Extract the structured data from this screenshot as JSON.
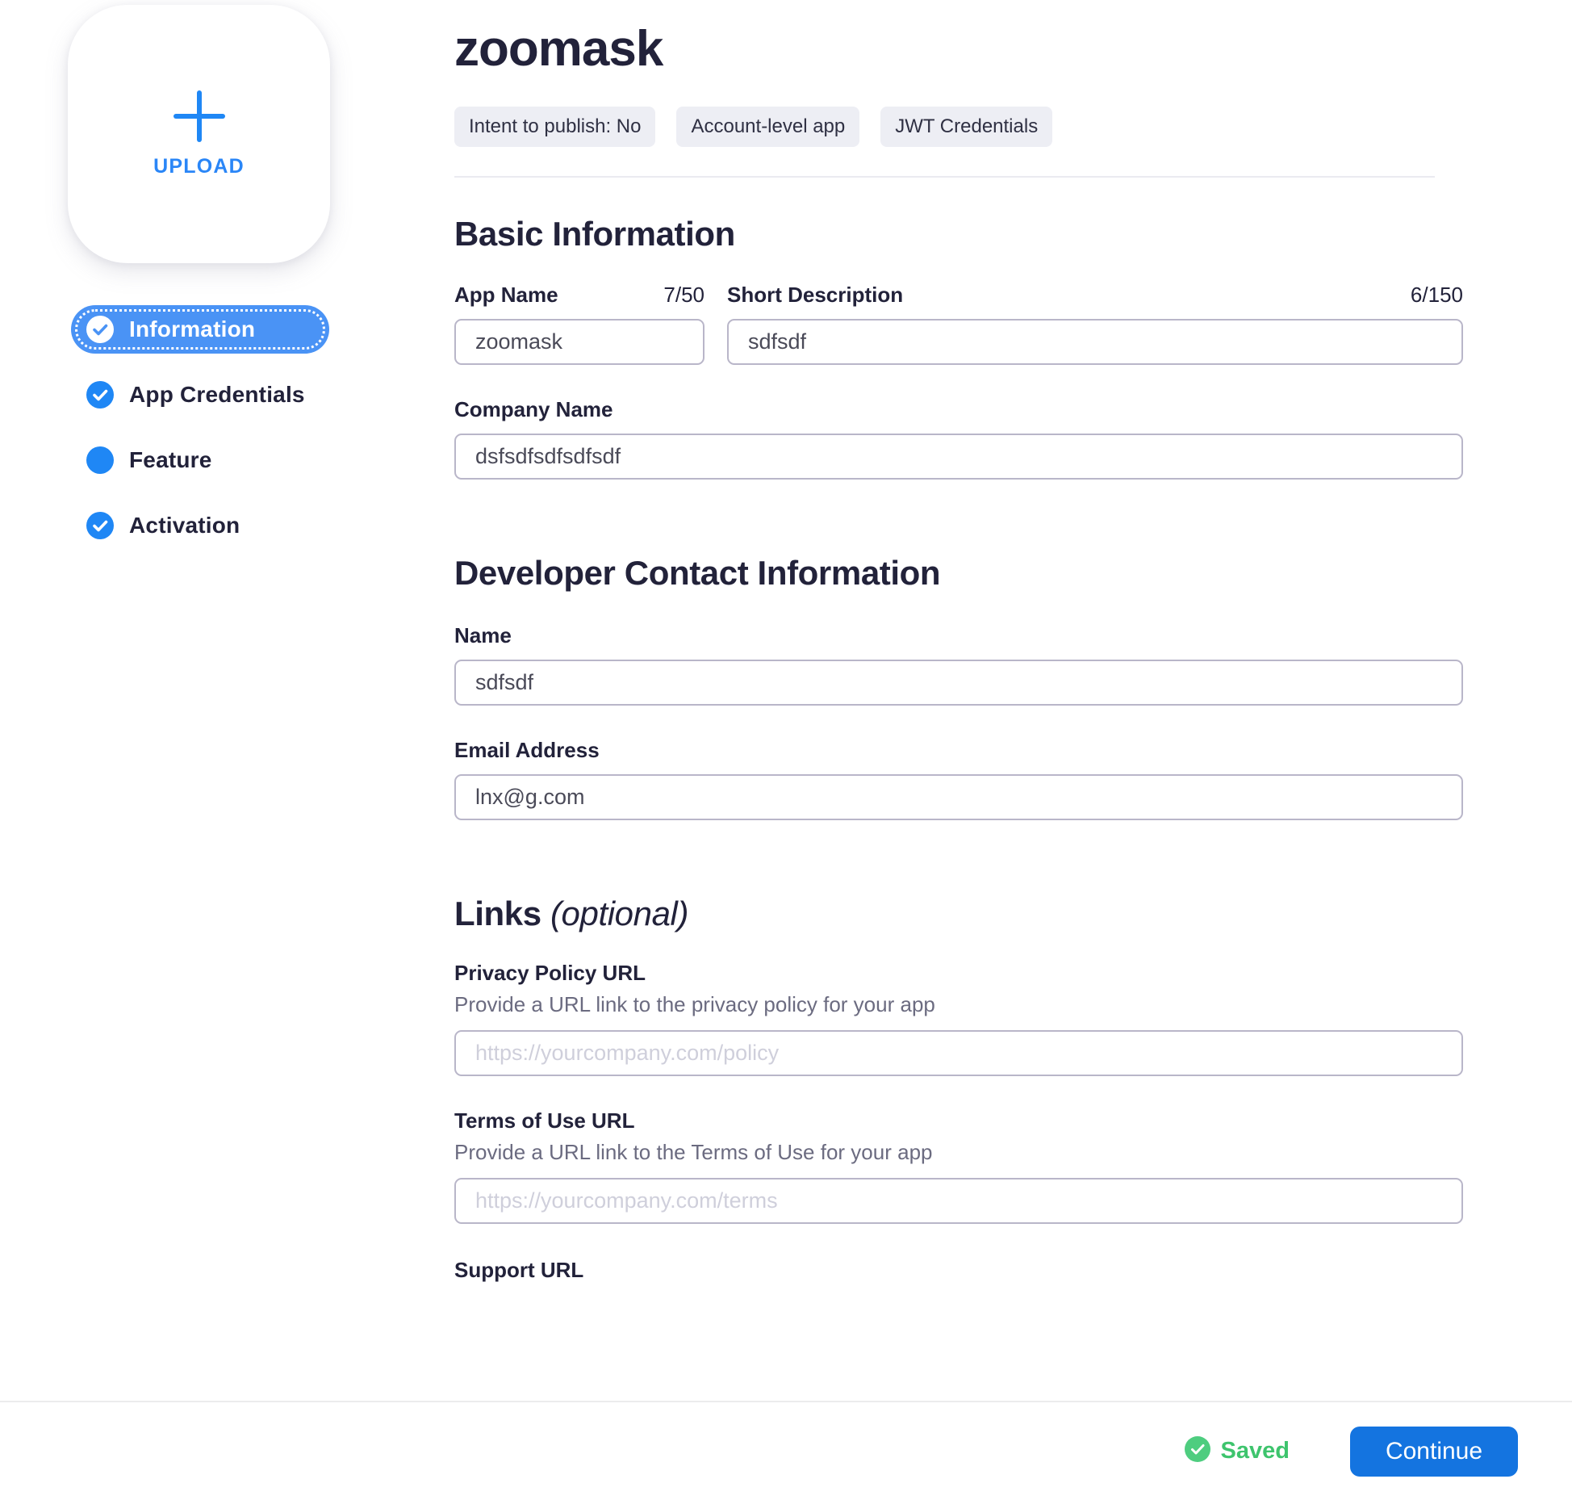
{
  "app": {
    "title": "zoomask",
    "chips": [
      "Intent to publish: No",
      "Account-level app",
      "JWT Credentials"
    ]
  },
  "sidebar": {
    "upload": {
      "label": "UPLOAD",
      "icon": "plus-icon"
    },
    "items": [
      {
        "label": "Information",
        "icon": "check-circle-icon",
        "state": "active"
      },
      {
        "label": "App Credentials",
        "icon": "check-circle-icon",
        "state": "complete"
      },
      {
        "label": "Feature",
        "icon": "dot-circle-icon",
        "state": "incomplete"
      },
      {
        "label": "Activation",
        "icon": "check-circle-icon",
        "state": "complete"
      }
    ]
  },
  "sections": {
    "basic_information": {
      "heading": "Basic Information",
      "app_name": {
        "label": "App Name",
        "counter": "7/50",
        "value": "zoomask",
        "placeholder": ""
      },
      "short_description": {
        "label": "Short Description",
        "counter": "6/150",
        "value": "sdfsdf",
        "placeholder": ""
      },
      "company_name": {
        "label": "Company Name",
        "value": "dsfsdfsdfsdfsdf",
        "placeholder": ""
      }
    },
    "developer_contact": {
      "heading": "Developer Contact Information",
      "name": {
        "label": "Name",
        "value": "sdfsdf",
        "placeholder": ""
      },
      "email": {
        "label": "Email Address",
        "value": "lnx@g.com",
        "placeholder": ""
      }
    },
    "links": {
      "heading": "Links ",
      "heading_optional": "(optional)",
      "privacy_policy": {
        "label": "Privacy Policy URL",
        "help": "Provide a URL link to the privacy policy for your app",
        "value": "",
        "placeholder": "https://yourcompany.com/policy"
      },
      "terms_of_use": {
        "label": "Terms of Use URL",
        "help": "Provide a URL link to the Terms of Use for your app",
        "value": "",
        "placeholder": "https://yourcompany.com/terms"
      },
      "support_url": {
        "label": "Support URL"
      }
    }
  },
  "footer": {
    "saved_label": "Saved",
    "saved_icon": "check-circle-icon",
    "continue_label": "Continue"
  },
  "colors": {
    "accent_blue": "#1474e0",
    "nav_blue": "#4a93f5",
    "icon_blue": "#1f87f5",
    "success_green": "#3ec46d",
    "chip_bg": "#edeef4",
    "text_dark": "#22223a",
    "input_border": "#b9b6c9"
  }
}
